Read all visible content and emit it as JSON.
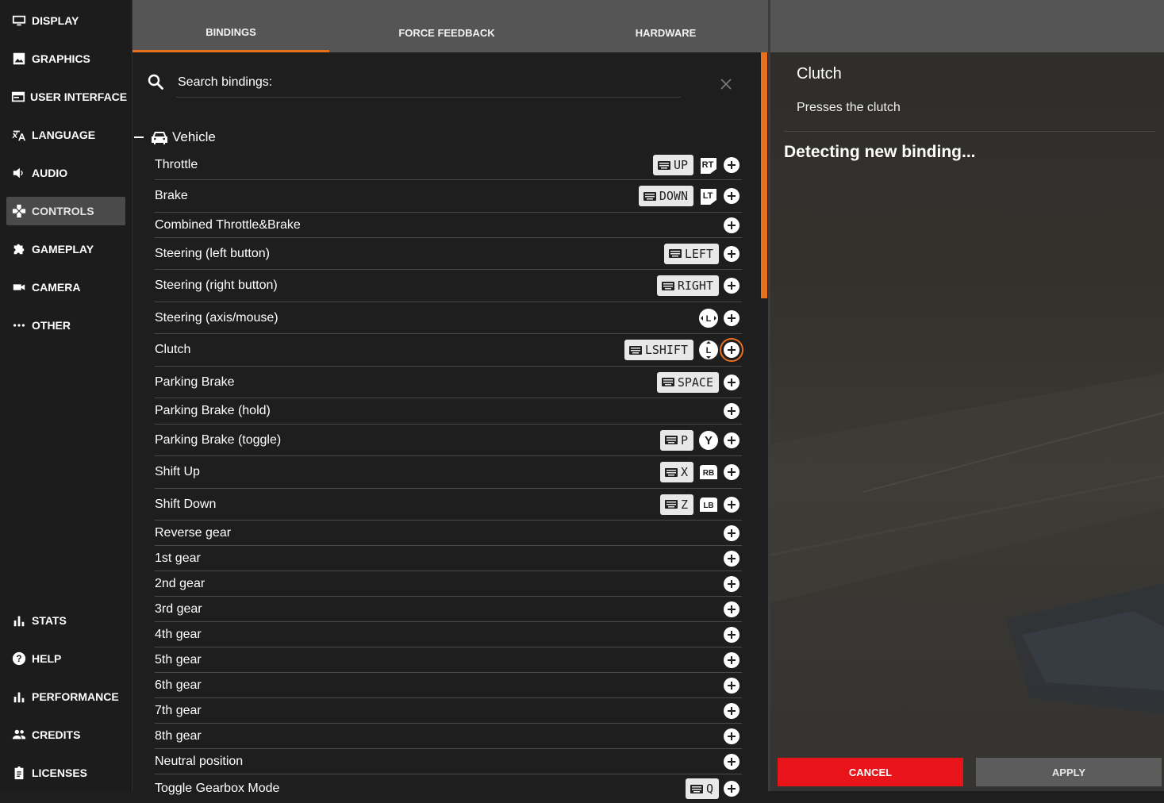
{
  "sidebar": {
    "top_items": [
      {
        "label": "DISPLAY",
        "icon": "display-icon"
      },
      {
        "label": "GRAPHICS",
        "icon": "graphics-icon"
      },
      {
        "label": "USER INTERFACE",
        "icon": "user-interface-icon"
      },
      {
        "label": "LANGUAGE",
        "icon": "language-icon"
      },
      {
        "label": "AUDIO",
        "icon": "audio-icon"
      },
      {
        "label": "CONTROLS",
        "icon": "controls-icon",
        "active": true
      },
      {
        "label": "GAMEPLAY",
        "icon": "gameplay-icon"
      },
      {
        "label": "CAMERA",
        "icon": "camera-icon"
      },
      {
        "label": "OTHER",
        "icon": "other-icon"
      }
    ],
    "bottom_items": [
      {
        "label": "STATS",
        "icon": "stats-icon"
      },
      {
        "label": "HELP",
        "icon": "help-icon"
      },
      {
        "label": "PERFORMANCE",
        "icon": "performance-icon"
      },
      {
        "label": "CREDITS",
        "icon": "credits-icon"
      },
      {
        "label": "LICENSES",
        "icon": "licenses-icon"
      }
    ]
  },
  "tabs": [
    {
      "label": "BINDINGS",
      "active": true
    },
    {
      "label": "FORCE FEEDBACK"
    },
    {
      "label": "HARDWARE"
    }
  ],
  "search": {
    "placeholder": "Search bindings:",
    "value": ""
  },
  "category": {
    "label": "Vehicle",
    "icon": "car-icon",
    "expanded": true
  },
  "bindings": [
    {
      "label": "Throttle",
      "key": "UP",
      "pad": "RT"
    },
    {
      "label": "Brake",
      "key": "DOWN",
      "pad": "LT"
    },
    {
      "label": "Combined Throttle&Brake"
    },
    {
      "label": "Steering (left button)",
      "key": "LEFT"
    },
    {
      "label": "Steering (right button)",
      "key": "RIGHT"
    },
    {
      "label": "Steering (axis/mouse)",
      "pad": "L-stick-horizontal"
    },
    {
      "label": "Clutch",
      "key": "LSHIFT",
      "pad": "L-stick-vertical",
      "focused": true
    },
    {
      "label": "Parking Brake",
      "key": "SPACE"
    },
    {
      "label": "Parking Brake (hold)"
    },
    {
      "label": "Parking Brake (toggle)",
      "key": "P",
      "pad": "Y"
    },
    {
      "label": "Shift Up",
      "key": "X",
      "pad": "RB"
    },
    {
      "label": "Shift Down",
      "key": "Z",
      "pad": "LB"
    },
    {
      "label": "Reverse gear"
    },
    {
      "label": "1st gear"
    },
    {
      "label": "2nd gear"
    },
    {
      "label": "3rd gear"
    },
    {
      "label": "4th gear"
    },
    {
      "label": "5th gear"
    },
    {
      "label": "6th gear"
    },
    {
      "label": "7th gear"
    },
    {
      "label": "8th gear"
    },
    {
      "label": "Neutral position"
    },
    {
      "label": "Toggle Gearbox Mode",
      "key": "Q"
    }
  ],
  "detail": {
    "title": "Clutch",
    "description": "Presses the clutch",
    "status": "Detecting new binding..."
  },
  "actions": {
    "cancel": "CANCEL",
    "apply": "APPLY"
  },
  "colors": {
    "accent": "#e8701c",
    "cancel": "#e8141a"
  }
}
